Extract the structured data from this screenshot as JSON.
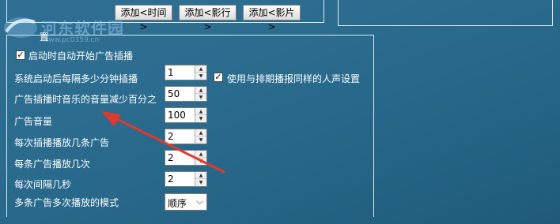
{
  "toolbar": {
    "add_time": "添加<时间>",
    "add_video": "添加<影行>",
    "add_film": "添加<影片>"
  },
  "watermark": {
    "text": "河东软件园",
    "url": "www.pc0359.cn"
  },
  "group": {
    "title": "置"
  },
  "options": {
    "auto_start_label": "启动时自动开始广告插播",
    "auto_start_checked": true,
    "use_same_voice_label": "使用与排期播报同样的人声设置",
    "use_same_voice_checked": true
  },
  "fields": [
    {
      "label": "系统启动后每隔多少分钟插播",
      "value": "1"
    },
    {
      "label": "广告插播时音乐的音量减少百分之",
      "value": "50"
    },
    {
      "label": "广告音量",
      "value": "100"
    },
    {
      "label": "每次插播播放几条广告",
      "value": "2"
    },
    {
      "label": "每条广告播放几次",
      "value": "2"
    },
    {
      "label": "每次间隔几秒",
      "value": "2"
    }
  ],
  "mode": {
    "label": "多条广告多次播放的模式",
    "value": "顺序"
  },
  "colors": {
    "background": "#2b6c8f",
    "annotation_arrow": "#e03a2e"
  }
}
